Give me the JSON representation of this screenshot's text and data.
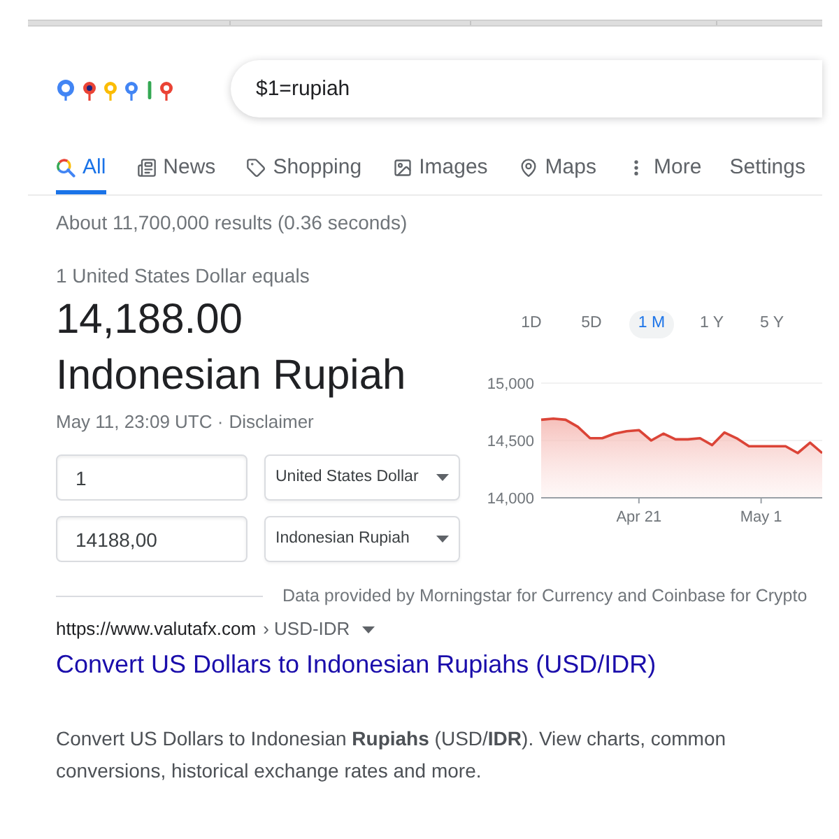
{
  "search": {
    "query": "$1=rupiah"
  },
  "tabs": [
    {
      "label": "All",
      "selected": true
    },
    {
      "label": "News",
      "selected": false
    },
    {
      "label": "Shopping",
      "selected": false
    },
    {
      "label": "Images",
      "selected": false
    },
    {
      "label": "Maps",
      "selected": false
    },
    {
      "label": "More",
      "selected": false
    }
  ],
  "settings_link": "Settings",
  "result_stats": "About 11,700,000 results (0.36 seconds)",
  "converter": {
    "caption": "1 United States Dollar equals",
    "amount": "14,188.00",
    "currency_name": "Indonesian Rupiah",
    "updated": "May 11, 23:09 UTC ·",
    "disclaimer": "Disclaimer",
    "rows": [
      {
        "value": "1",
        "currency": "United States Dollar"
      },
      {
        "value": "14188,00",
        "currency": "Indonesian Rupiah"
      }
    ]
  },
  "chart": {
    "ranges": [
      {
        "label": "1D",
        "selected": false
      },
      {
        "label": "5D",
        "selected": false
      },
      {
        "label": "1 M",
        "selected": true
      },
      {
        "label": "1 Y",
        "selected": false
      },
      {
        "label": "5 Y",
        "selected": false
      }
    ],
    "chart_data": {
      "type": "area",
      "categories": [
        null,
        null,
        null,
        null,
        null,
        null,
        null,
        null,
        "Apr 21",
        null,
        null,
        null,
        null,
        null,
        null,
        null,
        null,
        null,
        "May 1",
        null,
        null,
        null,
        null,
        null
      ],
      "series": [
        {
          "color": "#db4437",
          "values": [
            14680,
            14690,
            14680,
            14620,
            14520,
            14520,
            14560,
            14580,
            14590,
            14500,
            14560,
            14510,
            14510,
            14520,
            14460,
            14570,
            14520,
            14450,
            14450,
            14450,
            14450,
            14390,
            14480,
            14390
          ]
        }
      ],
      "ylim": [
        14000,
        15000
      ],
      "yticks": [
        {
          "value": 14000,
          "label": "14,000"
        },
        {
          "value": 14500,
          "label": "14,500"
        },
        {
          "value": 15000,
          "label": "15,000"
        }
      ]
    }
  },
  "attribution": "Data provided by Morningstar for Currency and Coinbase for Crypto",
  "result": {
    "url": "https://www.valutafx.com",
    "breadcrumb": "› USD-IDR",
    "title": "Convert US Dollars to Indonesian Rupiahs (USD/IDR)",
    "snippet": "Convert US Dollars to Indonesian **Rupiahs** (USD/**IDR**). View charts, common conversions, historical exchange rates and more."
  }
}
